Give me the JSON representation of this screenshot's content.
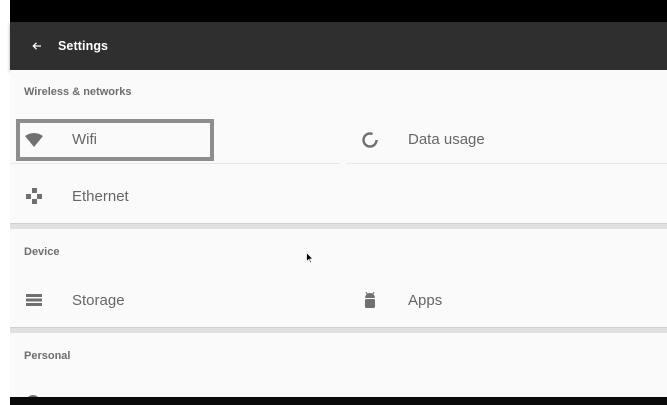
{
  "appbar": {
    "title": "Settings",
    "back_icon": "arrow-left-icon"
  },
  "sections": [
    {
      "header": "Wireless & networks",
      "items": [
        {
          "label": "Wifi",
          "icon": "wifi-icon"
        },
        {
          "label": "Data usage",
          "icon": "data-usage-icon"
        },
        {
          "label": "Ethernet",
          "icon": "ethernet-icon"
        }
      ]
    },
    {
      "header": "Device",
      "items": [
        {
          "label": "Storage",
          "icon": "storage-icon"
        },
        {
          "label": "Apps",
          "icon": "android-icon"
        }
      ]
    },
    {
      "header": "Personal",
      "items": []
    }
  ],
  "colors": {
    "appbar_bg": "#2f2f2f",
    "focus_border": "#8d8d8d",
    "icon": "#707070",
    "label": "#666666"
  }
}
